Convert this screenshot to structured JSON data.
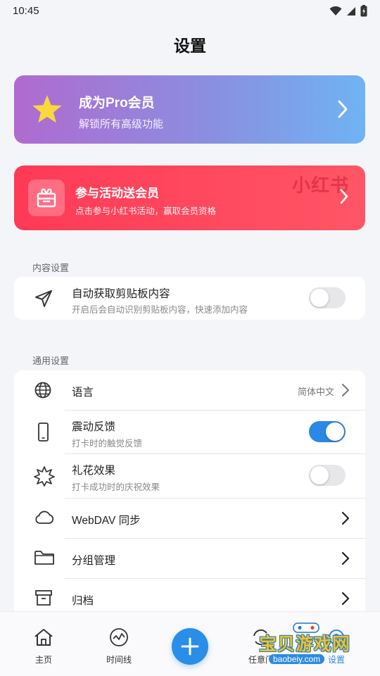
{
  "status_bar": {
    "time": "10:45"
  },
  "page": {
    "title": "设置"
  },
  "pro_card": {
    "title": "成为Pro会员",
    "subtitle": "解锁所有高级功能"
  },
  "promo_card": {
    "title": "参与活动送会员",
    "subtitle": "点击参与小红书活动，赢取会员资格",
    "watermark": "小红书"
  },
  "content_settings": {
    "label": "内容设置",
    "items": [
      {
        "title": "自动获取剪贴板内容",
        "subtitle": "开启后会自动识别剪贴板内容，快速添加内容",
        "toggle": "off",
        "icon": "send-icon"
      }
    ]
  },
  "general_settings": {
    "label": "通用设置",
    "items": [
      {
        "title": "语言",
        "value": "简体中文",
        "icon": "globe-icon"
      },
      {
        "title": "震动反馈",
        "subtitle": "打卡时的触觉反馈",
        "toggle": "on",
        "icon": "phone-icon"
      },
      {
        "title": "礼花效果",
        "subtitle": "打卡成功时的庆祝效果",
        "toggle": "off",
        "icon": "burst-icon"
      },
      {
        "title": "WebDAV 同步",
        "icon": "cloud-icon"
      },
      {
        "title": "分组管理",
        "icon": "folder-icon"
      },
      {
        "title": "归档",
        "icon": "archive-icon"
      }
    ]
  },
  "bottom_nav": {
    "items": [
      {
        "label": "主页",
        "icon": "home-icon"
      },
      {
        "label": "时间线",
        "icon": "timeline-icon"
      },
      {
        "label": "任意门",
        "icon": "refresh-icon"
      },
      {
        "label": "设置",
        "icon": "settings-icon"
      }
    ],
    "fab_icon": "plus-icon"
  },
  "watermark": {
    "text": "宝贝游戏网",
    "url": "baobeiy.com"
  },
  "colors": {
    "accent": "#2a88e6",
    "promo": "#ff3a57",
    "pro_start": "#b06ad0",
    "pro_end": "#6fb3f3"
  }
}
